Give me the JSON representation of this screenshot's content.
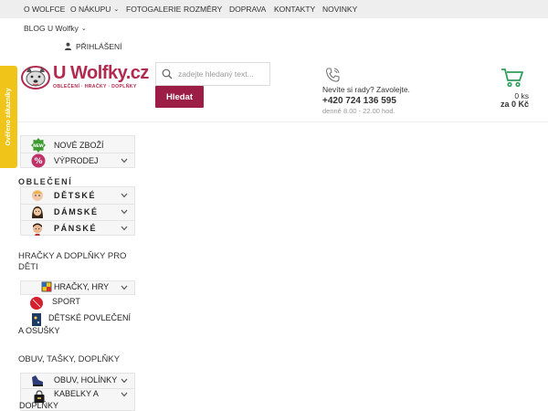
{
  "topnav": {
    "items": [
      {
        "label": "O WOLFCE"
      },
      {
        "label": "O NÁKUPU",
        "has_dropdown": true
      },
      {
        "label": "FOTOGALERIE"
      },
      {
        "label": "ROZMĚRY"
      },
      {
        "label": "DOPRAVA"
      },
      {
        "label": "KONTAKTY"
      },
      {
        "label": "NOVINKY"
      }
    ]
  },
  "blog": {
    "label": "BLOG U Wolfky",
    "has_dropdown": true
  },
  "login": {
    "label": "PŘIHLÁŠENÍ",
    "icon": "user-icon"
  },
  "logo": {
    "name": "U Wolfky.cz",
    "tagline": "OBLEČENÍ · HRAČKY · DOPLŇKY",
    "color": "#b22a4f"
  },
  "search": {
    "placeholder": "zadejte hledaný text...",
    "value": "",
    "button_label": "Hledat",
    "button_color": "#9c1d45"
  },
  "contact": {
    "question": "Nevíte si rady? Zavolejte.",
    "phone": "+420 724 136 595",
    "hours": "denně 8.00 - 22.00 hod.",
    "icon": "phone-icon"
  },
  "cart": {
    "count": "0 ks",
    "total": "za 0 Kč",
    "icon": "cart-icon",
    "accent": "#2e9e5b"
  },
  "verified_badge": {
    "label": "Ověřeno zákazníky",
    "color": "#f0c419"
  },
  "menu": {
    "top_items": [
      {
        "label": "NOVÉ ZBOŽÍ",
        "icon": "new-badge-icon"
      },
      {
        "label": "VÝPRODEJ",
        "icon": "sale-percent-icon",
        "has_dropdown": true
      }
    ],
    "obleceni": {
      "heading": "OBLEČENÍ",
      "items": [
        {
          "label": "DĚTSKÉ",
          "icon": "child-face-icon",
          "has_dropdown": true
        },
        {
          "label": "DÁMSKÉ",
          "icon": "woman-face-icon",
          "has_dropdown": true
        },
        {
          "label": "PÁNSKÉ",
          "icon": "man-face-icon",
          "has_dropdown": true
        }
      ]
    },
    "hracky": {
      "heading_line1": "HRAČKY A DOPLŇKY PRO",
      "heading_line2": "DĚTI",
      "items": [
        {
          "label": "HRAČKY, HRY",
          "icon": "toy-icon",
          "has_dropdown": true
        },
        {
          "label": "SPORT",
          "icon": "ball-icon"
        },
        {
          "label_line1": "DĚTSKÉ POVLEČENÍ",
          "label_line2": "A OSUŠKY",
          "icon": "bedding-icon"
        }
      ]
    },
    "obuv": {
      "heading": "OBUV, TAŠKY, DOPLŇKY",
      "items": [
        {
          "label": "OBUV, HOLÍNKY",
          "icon": "shoe-icon",
          "has_dropdown": true
        },
        {
          "label_line1": "KABELKY A",
          "label_line2": "DOPLŇKY",
          "icon": "handbag-icon",
          "has_dropdown": true
        }
      ]
    }
  }
}
